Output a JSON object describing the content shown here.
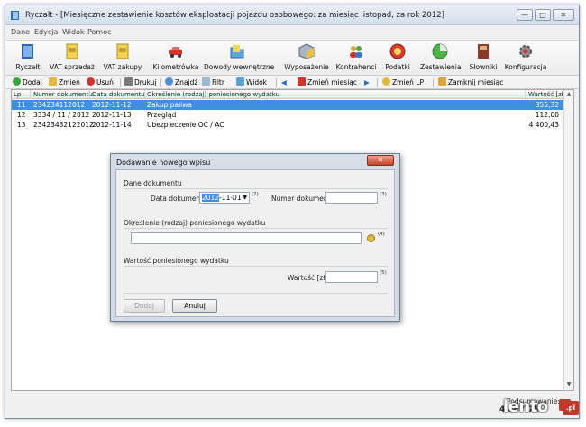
{
  "window": {
    "title": "Ryczałt - [Miesięczne zestawienie kosztów eksploatacji pojazdu osobowego: za miesiąc listopad, za rok 2012]",
    "controls": {
      "minimize": "—",
      "maximize": "□",
      "close": "✕"
    }
  },
  "menu": [
    "Dane",
    "Edycja",
    "Widok",
    "Pomoc"
  ],
  "toolbar": [
    {
      "label": "Ryczałt",
      "icon": "book-icon"
    },
    {
      "label": "VAT sprzedaż",
      "icon": "doc-icon"
    },
    {
      "label": "VAT zakupy",
      "icon": "doc-icon"
    },
    {
      "label": "Kilometrówka",
      "icon": "car-icon"
    },
    {
      "label": "Dowody wewnętrzne",
      "icon": "folder-icon"
    },
    {
      "label": "Wyposażenie",
      "icon": "box-icon"
    },
    {
      "label": "Kontrahenci",
      "icon": "people-icon"
    },
    {
      "label": "Podatki",
      "icon": "tax-icon"
    },
    {
      "label": "Zestawienia",
      "icon": "chart-icon"
    },
    {
      "label": "Słowniki",
      "icon": "dictionary-icon"
    },
    {
      "label": "Konfiguracja",
      "icon": "gear-icon"
    }
  ],
  "actions": {
    "add": "Dodaj",
    "edit": "Zmień",
    "delete": "Usuń",
    "print": "Drukuj",
    "find": "Znajdź",
    "filter": "Filtr",
    "view": "Widok",
    "change_month": "Zmień miesiąc",
    "change_lp": "Zmień LP",
    "close_month": "Zamknij miesiąc"
  },
  "grid": {
    "columns": [
      "Lp",
      "Numer dokumentu",
      "Data dokumentu",
      "Określenie (rodzaj) poniesionego wydatku",
      "Wartość [zł]"
    ],
    "rows": [
      {
        "lp": "11",
        "number": "234234112012",
        "date": "2012-11-12",
        "desc": "Zakup paliwa",
        "value": "355,32",
        "selected": true
      },
      {
        "lp": "12",
        "number": "3334 / 11 / 2012",
        "date": "2012-11-13",
        "desc": "Przegląd",
        "value": "112,00",
        "selected": false
      },
      {
        "lp": "13",
        "number": "23423432122012",
        "date": "2012-11-14",
        "desc": "Ubezpieczenie OC / AC",
        "value": "4 400,43",
        "selected": false
      }
    ]
  },
  "footer": {
    "sum_label": "Podsumowanie:",
    "sum_value": "4 867,75"
  },
  "dialog": {
    "title": "Dodawanie nowego wpisu",
    "close": "✕",
    "section_doc": "Dane dokumentu",
    "date_label": "Data dokumentu",
    "date_year": "2012",
    "date_rest": "-11-01",
    "date_sup": "(2)",
    "number_label": "Numer dokumentu",
    "number_value": "",
    "number_sup": "(3)",
    "section_desc": "Określenie (rodzaj) poniesionego wydatku",
    "desc_value": "",
    "desc_sup": "(4)",
    "section_value": "Wartość poniesionego wydatku",
    "value_label": "Wartość [zł]",
    "value_value": "",
    "value_sup": "(5)",
    "add_button": "Dodaj",
    "cancel_button": "Anuluj"
  },
  "watermark": {
    "text": "lento",
    "badge": ".pl"
  },
  "colors": {
    "selection": "#3d8fe0",
    "dialog_frame": "#d6dde7",
    "close_red": "#c7432a"
  }
}
